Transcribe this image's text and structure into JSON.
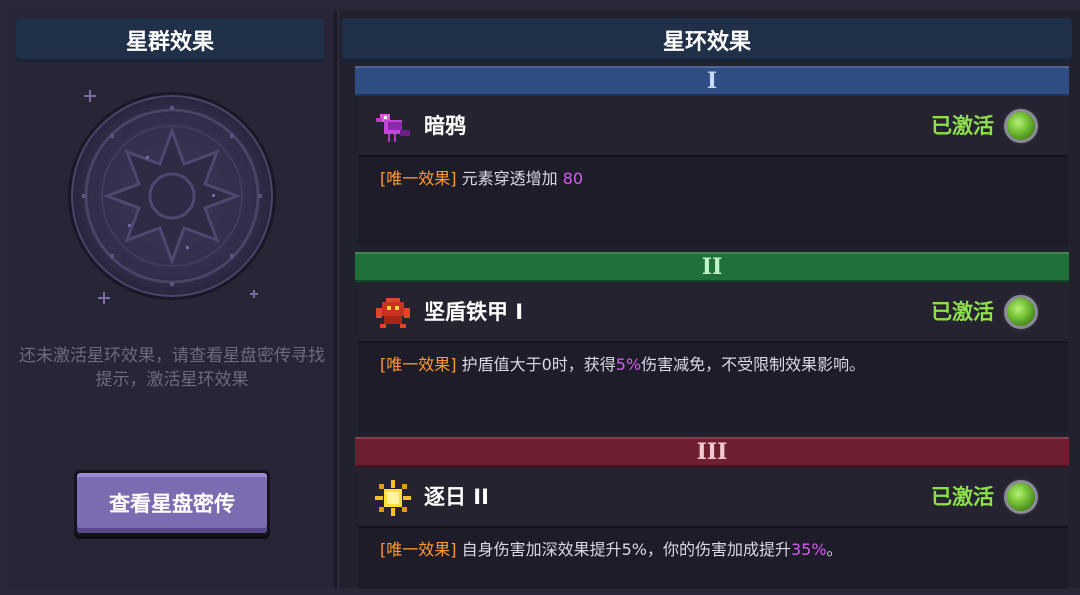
{
  "left": {
    "header": "星群效果",
    "hint": "还未激活星环效果，请查看星盘密传寻找提示，激活星环效果",
    "button_label": "查看星盘密传"
  },
  "right": {
    "header": "星环效果",
    "tiers": [
      {
        "numeral": "I",
        "color": "#2f4e84",
        "name": "暗鸦",
        "icon": "dark-crow-icon",
        "status": "已激活",
        "tag": "[唯一效果]",
        "desc_before": "元素穿透增加 ",
        "desc_highlight": "80",
        "desc_after": ""
      },
      {
        "numeral": "II",
        "color": "#20703a",
        "name": "坚盾铁甲 I",
        "icon": "iron-armor-crab-icon",
        "status": "已激活",
        "tag": "[唯一效果]",
        "desc_before": "护盾值大于0时，获得",
        "desc_highlight": "5%",
        "desc_after": "伤害减免，不受限制效果影响。"
      },
      {
        "numeral": "III",
        "color": "#6f2030",
        "name": "逐日 II",
        "icon": "sun-icon",
        "status": "已激活",
        "tag": "[唯一效果]",
        "desc_before": "自身伤害加深效果提升5%，你的伤害加成提升",
        "desc_highlight": "35%",
        "desc_after": "。"
      }
    ]
  },
  "colors": {
    "active_green": "#8de04a",
    "tag_orange": "#ff9a2e",
    "highlight_purple": "#d45cf2"
  }
}
